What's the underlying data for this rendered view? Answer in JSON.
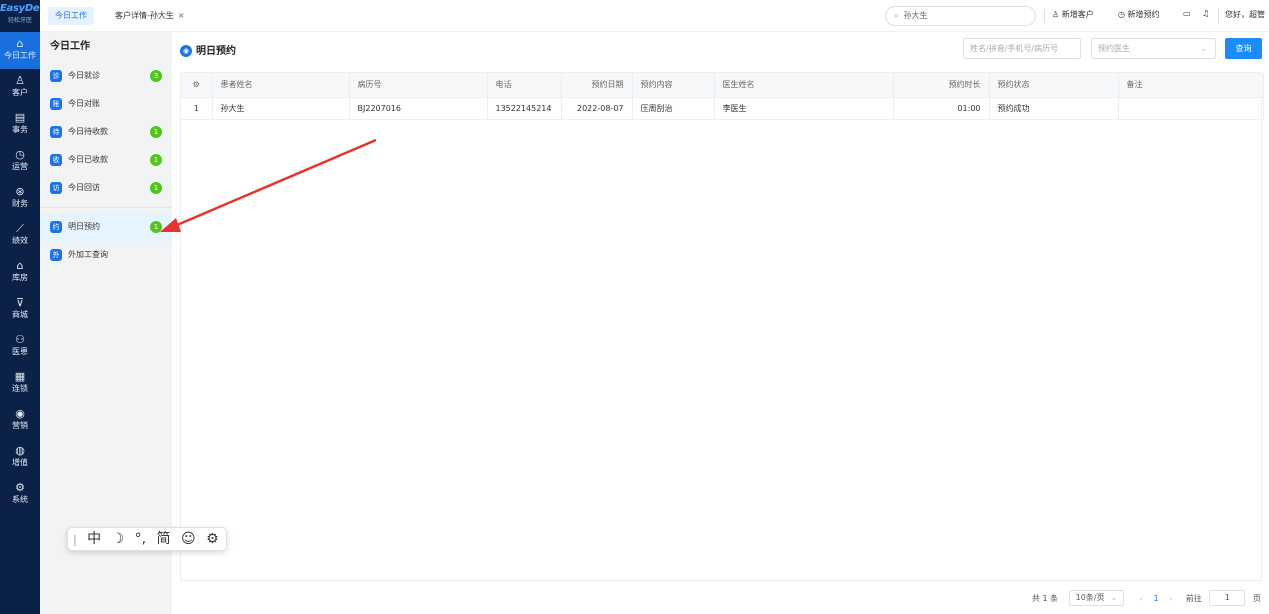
{
  "app": {
    "logo_text": "EasyDent",
    "logo_sub": "轻松牙医"
  },
  "leftnav": [
    {
      "icon": "⌂",
      "icon_name": "home-icon",
      "label": "今日工作"
    },
    {
      "icon": "♙",
      "icon_name": "customer-icon",
      "label": "客户"
    },
    {
      "icon": "▤",
      "icon_name": "affairs-icon",
      "label": "事务"
    },
    {
      "icon": "◷",
      "icon_name": "operation-icon",
      "label": "运营"
    },
    {
      "icon": "⊛",
      "icon_name": "finance-icon",
      "label": "财务"
    },
    {
      "icon": "⟋",
      "icon_name": "performance-icon",
      "label": "绩效"
    },
    {
      "icon": "⌂",
      "icon_name": "warehouse-icon",
      "label": "库房"
    },
    {
      "icon": "⊽",
      "icon_name": "mall-icon",
      "label": "商城"
    },
    {
      "icon": "⚇",
      "icon_name": "doctor-patient-icon",
      "label": "医患"
    },
    {
      "icon": "▦",
      "icon_name": "chain-icon",
      "label": "连锁"
    },
    {
      "icon": "◉",
      "icon_name": "marketing-icon",
      "label": "营销"
    },
    {
      "icon": "◍",
      "icon_name": "value-added-icon",
      "label": "增值"
    },
    {
      "icon": "⚙",
      "icon_name": "system-icon",
      "label": "系统"
    }
  ],
  "tabs": [
    {
      "label": "今日工作"
    },
    {
      "label": "客户详情-孙大生",
      "close": "×"
    }
  ],
  "topbar": {
    "search_value": "孙大生",
    "new_customer": "新增客户",
    "new_appointment": "新增预约",
    "greeting": "您好，超管"
  },
  "subpanel": {
    "title": "今日工作",
    "items": [
      {
        "label": "今日就诊",
        "icon": "诊",
        "badge": "3"
      },
      {
        "label": "今日对账",
        "icon": "账",
        "badge": ""
      },
      {
        "label": "今日待收款",
        "icon": "待",
        "badge": "1"
      },
      {
        "label": "今日已收款",
        "icon": "收",
        "badge": "1"
      },
      {
        "label": "今日回访",
        "icon": "访",
        "badge": "1"
      },
      {
        "label": "明日预约",
        "icon": "约",
        "badge": "1"
      },
      {
        "label": "外加工查询",
        "icon": "外",
        "badge": ""
      }
    ]
  },
  "main": {
    "title": "明日预约",
    "filter_placeholder": "姓名/拼音/手机号/病历号",
    "doctor_placeholder": "预约医生",
    "query_btn": "查询",
    "columns": [
      "患者姓名",
      "病历号",
      "电话",
      "预约日期",
      "预约内容",
      "医生姓名",
      "预约时长",
      "预约状态",
      "备注"
    ],
    "rows": [
      {
        "idx": "1",
        "name": "孙大生",
        "record": "BJ2207016",
        "phone": "13522145214",
        "date": "2022-08-07",
        "content": "压周刮治",
        "doctor": "李医生",
        "duration": "01:00",
        "status": "预约成功",
        "note": ""
      }
    ]
  },
  "pager": {
    "total": "共 1 条",
    "page_size": "10条/页",
    "current": "1",
    "goto_label": "前往",
    "goto_value": "1",
    "page_unit": "页"
  },
  "ime": {
    "items": [
      "中",
      "☽",
      "°,",
      "简",
      "☺",
      "⚙"
    ]
  },
  "colors": {
    "nav_bg": "#0b2147",
    "accent": "#1a73e8",
    "badge": "#52c41a",
    "arrow": "#e8322c"
  }
}
